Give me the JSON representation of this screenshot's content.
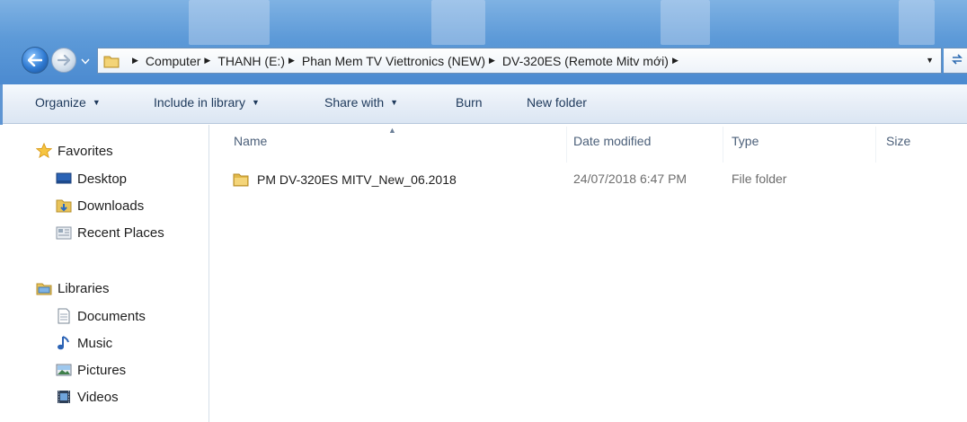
{
  "navigation": {
    "back_icon": "back-arrow-icon",
    "forward_icon": "forward-arrow-icon",
    "address": {
      "breadcrumbs": [
        "Computer",
        "THANH (E:)",
        "Phan Mem TV Viettronics (NEW)",
        "DV-320ES (Remote Mitv mới)"
      ]
    }
  },
  "toolbar": {
    "organize": "Organize",
    "include_in_library": "Include in library",
    "share_with": "Share with",
    "burn": "Burn",
    "new_folder": "New folder"
  },
  "sidebar": {
    "favorites_header": "Favorites",
    "favorites": [
      "Desktop",
      "Downloads",
      "Recent Places"
    ],
    "libraries_header": "Libraries",
    "libraries": [
      "Documents",
      "Music",
      "Pictures",
      "Videos"
    ]
  },
  "file_list": {
    "columns": {
      "name": "Name",
      "date_modified": "Date modified",
      "type": "Type",
      "size": "Size"
    },
    "rows": [
      {
        "name": "PM DV-320ES MITV_New_06.2018",
        "date_modified": "24/07/2018 6:47 PM",
        "type": "File folder",
        "size": ""
      }
    ]
  },
  "colors": {
    "titlebar": "#5d9ad8",
    "toolbar_text": "#1e395b",
    "header_text": "#4c607a",
    "secondary_text": "#6d6d6d",
    "folder_yellow": "#e8c35a"
  }
}
